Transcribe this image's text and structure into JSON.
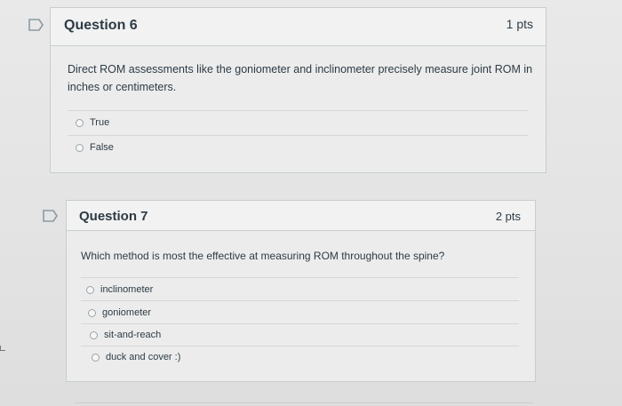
{
  "q6": {
    "title": "Question 6",
    "points": "1 pts",
    "text": "Direct ROM assessments like the goniometer and inclinometer precisely measure joint ROM in inches or centimeters.",
    "answers": [
      "True",
      "False"
    ]
  },
  "q7": {
    "title": "Question 7",
    "points": "2 pts",
    "text": "Which method is most the effective at measuring ROM throughout the spine?",
    "answers": [
      "inclinometer",
      "goniometer",
      "sit-and-reach",
      "duck and cover :)"
    ]
  },
  "icons": {
    "flag": "flag-icon",
    "radio": "radio-icon"
  },
  "colors": {
    "flag": "#8b9aa3",
    "text": "#2d3b45",
    "border": "#c7cdd1"
  }
}
